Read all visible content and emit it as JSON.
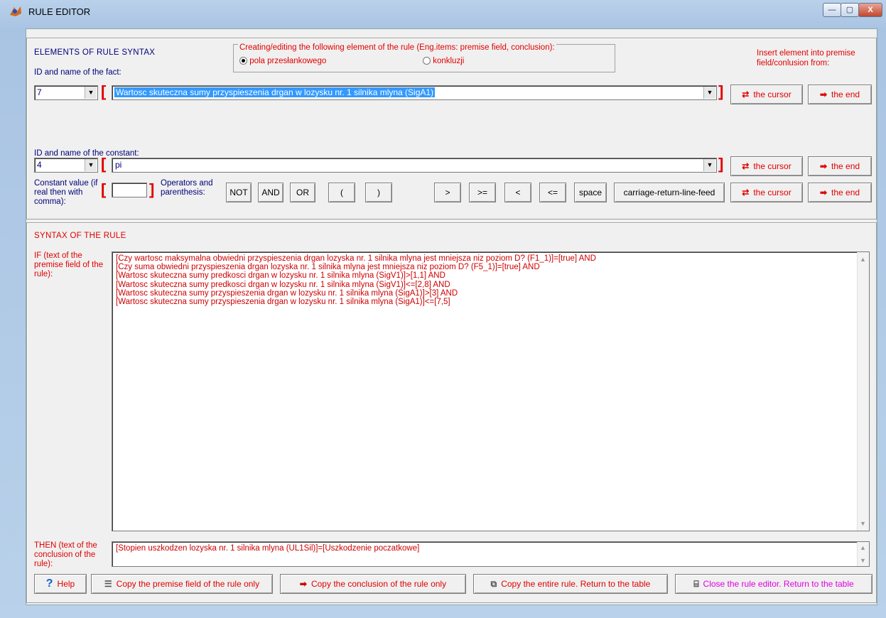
{
  "window": {
    "title": "RULE EDITOR",
    "minimize": "—",
    "maximize": "▢",
    "close": "X"
  },
  "syntax_elements": {
    "header": "ELEMENTS OF RULE SYNTAX",
    "fact_label": "ID and name of the fact:",
    "fact_id": "7",
    "fact_name": "Wartosc skuteczna sumy przyspieszenia drgan w lozysku nr. 1 silnika mlyna (SigA1)",
    "constant_label": "ID and name of the constant:",
    "constant_id": "4",
    "constant_name": "pi",
    "constant_value_label": "Constant value (if real then with comma):",
    "constant_value": "",
    "operators_label": "Operators and parenthesis:"
  },
  "mode_group": {
    "legend": "Creating/editing the following element of the rule (Eng.items: premise field, conclusion):",
    "option_premise": "pola przesłankowego",
    "option_conclusion": "konkluzji"
  },
  "insert_header": "Insert element into premise field/conlusion from:",
  "insert_buttons": {
    "cursor": "the cursor",
    "end": "the end"
  },
  "operators": [
    "NOT",
    "AND",
    "OR",
    "(",
    ")"
  ],
  "comparators": [
    ">",
    ">=",
    "<",
    "<=",
    "space",
    "carriage-return-line-feed"
  ],
  "rule_syntax": {
    "header": "SYNTAX OF THE RULE",
    "if_label": "IF (text of the premise field of the rule):",
    "premise_lines": [
      "[Czy wartosc maksymalna obwiedni przyspieszenia drgan lozyska nr. 1 silnika mlyna jest mniejsza niz poziom D? (F1_1)]=[true] AND",
      "[Czy suma obwiedni przyspieszenia drgan lozyska nr. 1 silnika mlyna jest mniejsza niz poziom D? (F5_1)]=[true] AND",
      "[Wartosc skuteczna sumy predkosci drgan w lozysku nr. 1 silnika mlyna (SigV1)]>[1,1] AND",
      "[Wartosc skuteczna sumy predkosci drgan w lozysku nr. 1 silnika mlyna (SigV1)]<=[2,8] AND",
      "[Wartosc skuteczna sumy przyspieszenia drgan w lozysku nr. 1 silnika mlyna (SigA1)]>[3] AND",
      "[Wartosc skuteczna sumy przyspieszenia drgan w lozysku nr. 1 silnika mlyna (SigA1)]<=[7,5]"
    ],
    "then_label": "THEN (text of the conclusion of the rule):",
    "conclusion": "[Stopien uszkodzen lozyska nr. 1 silnika mlyna (UL1Sil)]=[Uszkodzenie poczatkowe]"
  },
  "bottom_buttons": {
    "help": "Help",
    "copy_premise": "Copy the premise field of the rule only",
    "copy_conclusion": "Copy the conclusion of the rule only",
    "copy_entire": "Copy the entire rule. Return to the table",
    "close": "Close the rule editor. Return to the table"
  },
  "colors": {
    "label_blue": "#00007a",
    "accent_red": "#e00000",
    "close_pink": "#e000e0",
    "selection": "#3399ff"
  }
}
